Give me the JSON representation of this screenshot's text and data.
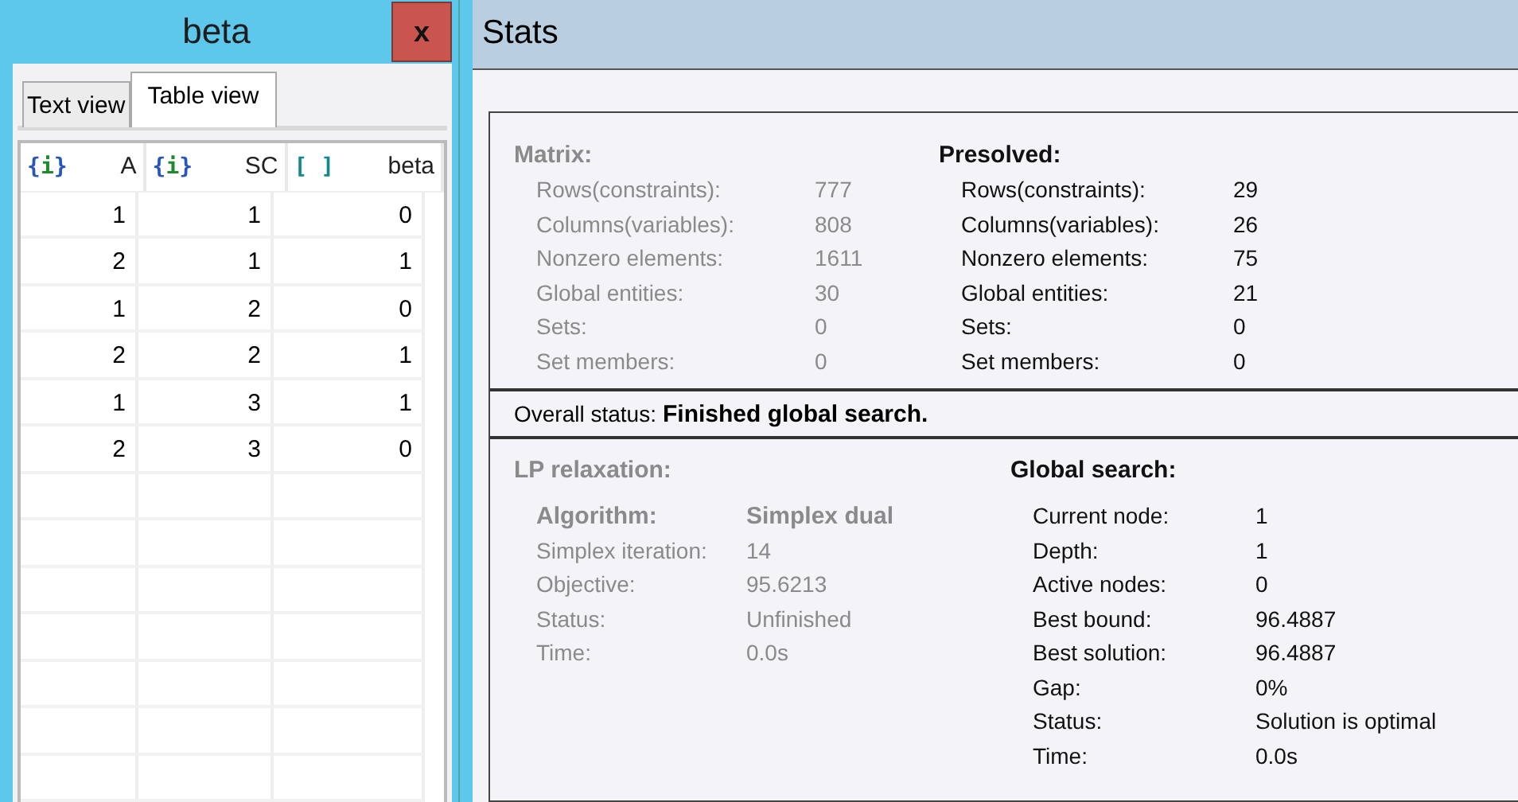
{
  "side_panel": {
    "title": "beta",
    "close": "x",
    "tabs": [
      {
        "label": "Text view",
        "selected": false
      },
      {
        "label": "Table view",
        "selected": true
      }
    ],
    "table": {
      "columns": [
        {
          "kind": "index",
          "icon": "{i}",
          "label": "A"
        },
        {
          "kind": "index",
          "icon": "{i}",
          "label": "SC"
        },
        {
          "kind": "array",
          "icon": "[ ]",
          "label": "beta"
        }
      ],
      "rows": [
        [
          "1",
          "1",
          "0"
        ],
        [
          "2",
          "1",
          "1"
        ],
        [
          "1",
          "2",
          "0"
        ],
        [
          "2",
          "2",
          "1"
        ],
        [
          "1",
          "3",
          "1"
        ],
        [
          "2",
          "3",
          "0"
        ]
      ]
    }
  },
  "stats": {
    "title": "Stats",
    "top": [
      {
        "heading": "Matrix:",
        "disabled": true,
        "items": [
          [
            "Rows(constraints):",
            "777"
          ],
          [
            "Columns(variables):",
            "808"
          ],
          [
            "Nonzero elements:",
            "1611"
          ],
          [
            "Global entities:",
            "30"
          ],
          [
            "Sets:",
            "0"
          ],
          [
            "Set members:",
            "0"
          ]
        ]
      },
      {
        "heading": "Presolved:",
        "disabled": false,
        "items": [
          [
            "Rows(constraints):",
            "29"
          ],
          [
            "Columns(variables):",
            "26"
          ],
          [
            "Nonzero elements:",
            "75"
          ],
          [
            "Global entities:",
            "21"
          ],
          [
            "Sets:",
            "0"
          ],
          [
            "Set members:",
            "0"
          ]
        ]
      }
    ],
    "overall_status": {
      "label": "Overall status:",
      "value": "Finished global search."
    },
    "bottom": [
      {
        "heading": "LP relaxation:",
        "disabled": true,
        "algorithm": [
          "Algorithm:",
          "Simplex dual"
        ],
        "items": [
          [
            "Simplex iteration:",
            "14"
          ],
          [
            "Objective:",
            "95.6213"
          ],
          [
            "Status:",
            "Unfinished"
          ],
          [
            "Time:",
            "0.0s"
          ]
        ]
      },
      {
        "heading": "Global search:",
        "disabled": false,
        "items": [
          [
            "Current node:",
            "1"
          ],
          [
            "Depth:",
            "1"
          ],
          [
            "Active nodes:",
            "0"
          ],
          [
            "Best bound:",
            "96.4887"
          ],
          [
            "Best solution:",
            "96.4887"
          ],
          [
            "Gap:",
            "0%"
          ],
          [
            "Status:",
            "Solution is optimal"
          ],
          [
            "Time:",
            "0.0s"
          ]
        ]
      }
    ]
  }
}
